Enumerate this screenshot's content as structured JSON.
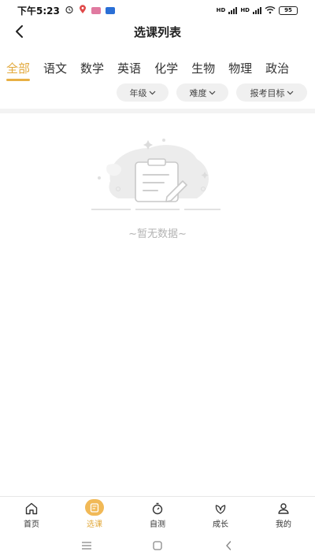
{
  "status_bar": {
    "time": "下午5:23",
    "network_1": "HD",
    "network_2": "HD",
    "battery": "95"
  },
  "header": {
    "title": "选课列表"
  },
  "tabs": [
    {
      "label": "全部",
      "active": true
    },
    {
      "label": "语文",
      "active": false
    },
    {
      "label": "数学",
      "active": false
    },
    {
      "label": "英语",
      "active": false
    },
    {
      "label": "化学",
      "active": false
    },
    {
      "label": "生物",
      "active": false
    },
    {
      "label": "物理",
      "active": false
    },
    {
      "label": "政治",
      "active": false
    }
  ],
  "filters": {
    "grade": "年级",
    "difficulty": "难度",
    "target": "报考目标"
  },
  "empty_state": {
    "message": "~暂无数据~",
    "icon": "clipboard-edit-icon"
  },
  "bottom_nav": [
    {
      "label": "首页",
      "icon": "home-icon",
      "active": false
    },
    {
      "label": "选课",
      "icon": "course-select-icon",
      "active": true
    },
    {
      "label": "自测",
      "icon": "stopwatch-icon",
      "active": false
    },
    {
      "label": "成长",
      "icon": "leaf-icon",
      "active": false
    },
    {
      "label": "我的",
      "icon": "user-icon",
      "active": false
    }
  ],
  "colors": {
    "accent": "#e2a93c",
    "accent_fill": "#f1b957",
    "muted_text": "#b3b3b3"
  }
}
